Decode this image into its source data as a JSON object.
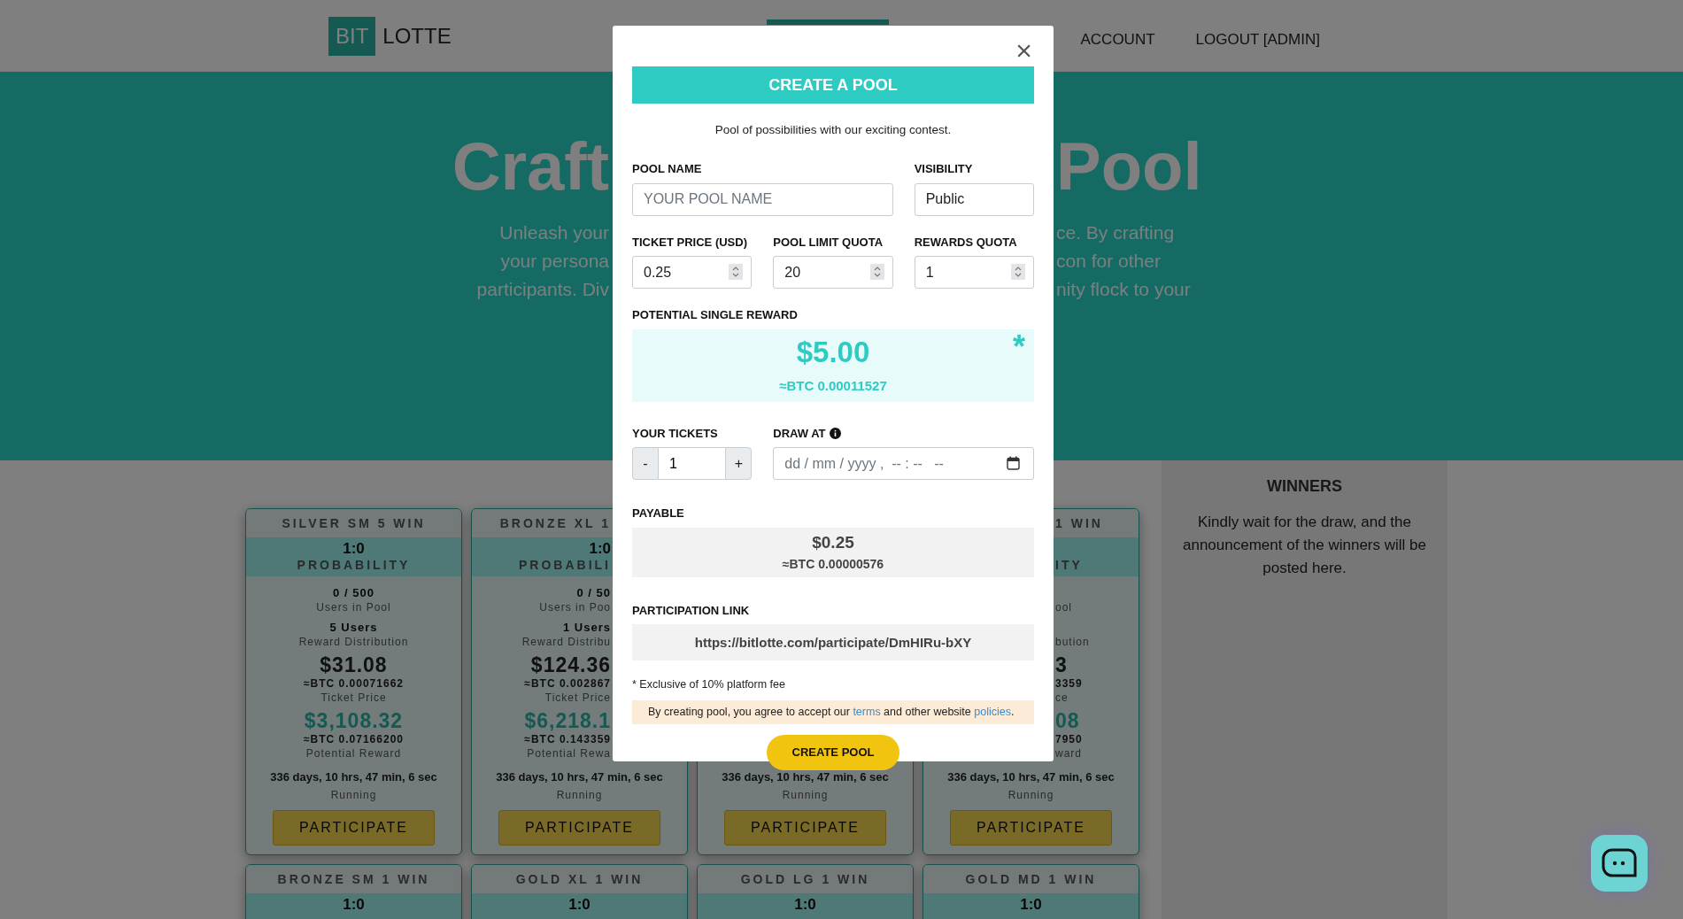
{
  "header": {
    "logo_box": "BIT",
    "logo_text": "LOTTE",
    "nav": [
      {
        "label": "ACCOUNT"
      },
      {
        "label": "LOGOUT [ADMIN]"
      }
    ]
  },
  "hero": {
    "title_left": "Craft",
    "title_right": "Pool",
    "lines_left": [
      "Unleash your",
      "your persona",
      "participants. Div"
    ],
    "lines_right": [
      "ce. By crafting",
      "con for other",
      "nity flock to your"
    ]
  },
  "cards": [
    {
      "kind": "full",
      "title": "SILVER SM 5 WIN",
      "ratio": "1:0",
      "ratio_label": "PROBABILITY",
      "users": "0 / 500",
      "users_label": "Users in Pool",
      "winners": "5 Users",
      "winners_label": "Reward Distribution",
      "ticket_price": "$31.08",
      "ticket_price_btc": "≈BTC 0.00071662",
      "ticket_price_label": "Ticket Price",
      "reward": "$3,108.32",
      "reward_btc": "≈BTC 0.07166200",
      "reward_label": "Potential Reward",
      "timer": "336 days, 10 hrs, 47 min, 6 sec",
      "status": "Running",
      "button": "PARTICIPATE"
    },
    {
      "kind": "left-part",
      "title": "BRONZE XL 1",
      "ratio": "1:0",
      "ratio_label": "PROBABILI",
      "users": "0 / 50",
      "users_label": "Users in Poo",
      "winners": "1 Users",
      "winners_label": "Reward Distribu",
      "ticket_price": "$124.36",
      "ticket_price_btc": "≈BTC 0.002867",
      "ticket_price_label": "Ticket Price",
      "reward": "$6,218.1",
      "reward_btc": "≈BTC 0.143359",
      "reward_label": "Potential Rewa",
      "timer": "336 days, 10 hrs, 47 min, 6 sec",
      "status": "Running",
      "button": "PARTICIPATE"
    },
    {
      "kind": "bottom-part",
      "timer": "336 days, 10 hrs, 47 min, 6 sec",
      "status": "Running",
      "button": "PARTICIPATE"
    },
    {
      "kind": "right-part",
      "title": "1 WIN",
      "ratio_label": "ITY",
      "users_label": "ool",
      "winners_label": "bution",
      "ticket_price": "3",
      "ticket_price_btc": "3359",
      "ticket_price_label": "ce",
      "reward": "08",
      "reward_btc": "7950",
      "reward_label": "ward",
      "timer": "336 days, 10 hrs, 47 min, 6 sec",
      "status": "Running",
      "button": "PARTICIPATE"
    },
    {
      "kind": "top-part",
      "title": "BRONZE SM 1 WIN",
      "ratio": "1:0"
    },
    {
      "kind": "top-part",
      "title": "GOLD XL 1 WIN",
      "ratio": "1:0"
    },
    {
      "kind": "top-part",
      "title": "GOLD LG 1 WIN",
      "ratio": "1:0"
    },
    {
      "kind": "top-part",
      "title": "GOLD MD 1 WIN",
      "ratio": "1:0"
    }
  ],
  "winners": {
    "title": "WINNERS",
    "message": "Kindly wait for the draw, and the announcement of the winners will be posted here."
  },
  "modal": {
    "close": "×",
    "title": "CREATE A POOL",
    "subtitle": "Pool of possibilities with our exciting contest.",
    "pool_name": {
      "label": "POOL NAME",
      "placeholder": "YOUR POOL NAME"
    },
    "visibility": {
      "label": "VISIBILITY",
      "value": "Public"
    },
    "numbers": [
      {
        "label": "TICKET PRICE (USD)",
        "value": "0.25"
      },
      {
        "label": "POOL LIMIT QUOTA",
        "value": "20"
      },
      {
        "label": "REWARDS QUOTA",
        "value": "1"
      }
    ],
    "reward": {
      "label": "POTENTIAL SINGLE REWARD",
      "amount": "$5.00",
      "btc": "≈BTC 0.00011527",
      "mark": "*"
    },
    "tickets": {
      "label": "YOUR TICKETS",
      "minus": "-",
      "value": "1",
      "plus": "+"
    },
    "draw_at": {
      "label": "DRAW AT",
      "placeholder": "dd / mm / yyyy ,  -- : --   --"
    },
    "payable": {
      "label": "PAYABLE",
      "amount": "$0.25",
      "btc": "≈BTC 0.00000576"
    },
    "link": {
      "label": "PARTICIPATION LINK",
      "url": "https://bitlotte.com/participate/DmHIRu-bXY"
    },
    "note": "* Exclusive of 10% platform fee",
    "agreement": {
      "before": "By creating pool, you agree to accept our",
      "terms": "terms",
      "middle": "and other website",
      "policies": "policies",
      "after": "."
    },
    "submit": "CREATE POOL"
  }
}
